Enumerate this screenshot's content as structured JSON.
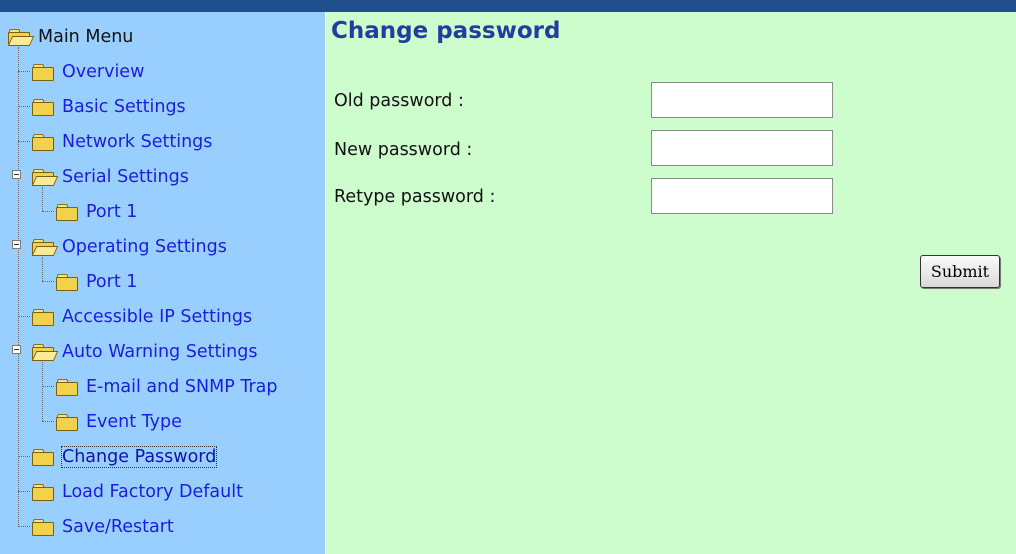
{
  "sidebar": {
    "items": [
      {
        "label": "Main Menu"
      },
      {
        "label": "Overview"
      },
      {
        "label": "Basic Settings"
      },
      {
        "label": "Network Settings"
      },
      {
        "label": "Serial Settings"
      },
      {
        "label": "Port 1"
      },
      {
        "label": "Operating Settings"
      },
      {
        "label": "Port 1"
      },
      {
        "label": "Accessible IP Settings"
      },
      {
        "label": "Auto Warning Settings"
      },
      {
        "label": "E-mail and SNMP Trap"
      },
      {
        "label": "Event Type"
      },
      {
        "label": "Change Password"
      },
      {
        "label": "Load Factory Default"
      },
      {
        "label": "Save/Restart"
      }
    ],
    "selected": "Change Password"
  },
  "main": {
    "title": "Change password",
    "fields": [
      {
        "label": "Old password :",
        "value": ""
      },
      {
        "label": "New password :",
        "value": ""
      },
      {
        "label": "Retype password :",
        "value": ""
      }
    ],
    "submit_label": "Submit"
  },
  "colors": {
    "topbar": "#1f4e8c",
    "sidebar_bg": "#99cfff",
    "content_bg": "#cdfccd",
    "link": "#1c1cdc",
    "title": "#1f3fa0"
  }
}
